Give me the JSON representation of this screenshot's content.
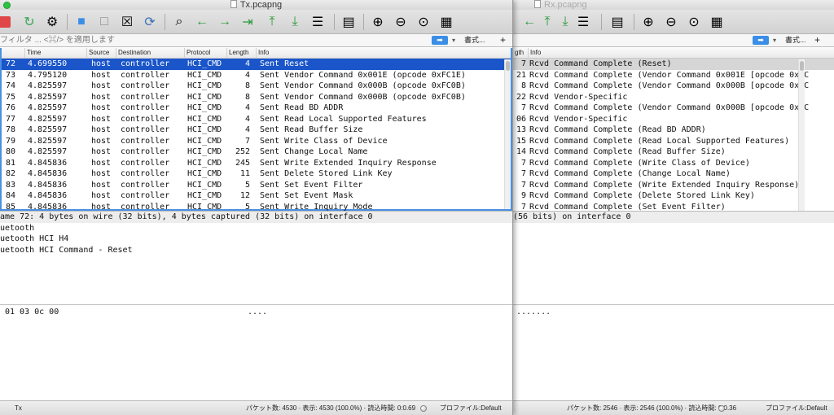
{
  "tx": {
    "title": "Tx.pcapng",
    "filter_placeholder": "フィルタ ... <⌘/> を適用します",
    "format_label": "書式...",
    "add_label": "+",
    "columns": [
      "Time",
      "Source",
      "Destination",
      "Protocol",
      "Length",
      "Info"
    ],
    "rows": [
      {
        "no": "72",
        "time": "4.699550",
        "src": "host",
        "dst": "controller",
        "proto": "HCI_CMD",
        "len": "4",
        "info": "Sent Reset"
      },
      {
        "no": "73",
        "time": "4.795120",
        "src": "host",
        "dst": "controller",
        "proto": "HCI_CMD",
        "len": "4",
        "info": "Sent Vendor Command 0x001E (opcode 0xFC1E)"
      },
      {
        "no": "74",
        "time": "4.825597",
        "src": "host",
        "dst": "controller",
        "proto": "HCI_CMD",
        "len": "8",
        "info": "Sent Vendor Command 0x000B (opcode 0xFC0B)"
      },
      {
        "no": "75",
        "time": "4.825597",
        "src": "host",
        "dst": "controller",
        "proto": "HCI_CMD",
        "len": "8",
        "info": "Sent Vendor Command 0x000B (opcode 0xFC0B)"
      },
      {
        "no": "76",
        "time": "4.825597",
        "src": "host",
        "dst": "controller",
        "proto": "HCI_CMD",
        "len": "4",
        "info": "Sent Read BD ADDR"
      },
      {
        "no": "77",
        "time": "4.825597",
        "src": "host",
        "dst": "controller",
        "proto": "HCI_CMD",
        "len": "4",
        "info": "Sent Read Local Supported Features"
      },
      {
        "no": "78",
        "time": "4.825597",
        "src": "host",
        "dst": "controller",
        "proto": "HCI_CMD",
        "len": "4",
        "info": "Sent Read Buffer Size"
      },
      {
        "no": "79",
        "time": "4.825597",
        "src": "host",
        "dst": "controller",
        "proto": "HCI_CMD",
        "len": "7",
        "info": "Sent Write Class of Device"
      },
      {
        "no": "80",
        "time": "4.825597",
        "src": "host",
        "dst": "controller",
        "proto": "HCI_CMD",
        "len": "252",
        "info": "Sent Change Local Name"
      },
      {
        "no": "81",
        "time": "4.845836",
        "src": "host",
        "dst": "controller",
        "proto": "HCI_CMD",
        "len": "245",
        "info": "Sent Write Extended Inquiry Response"
      },
      {
        "no": "82",
        "time": "4.845836",
        "src": "host",
        "dst": "controller",
        "proto": "HCI_CMD",
        "len": "11",
        "info": "Sent Delete Stored Link Key"
      },
      {
        "no": "83",
        "time": "4.845836",
        "src": "host",
        "dst": "controller",
        "proto": "HCI_CMD",
        "len": "5",
        "info": "Sent Set Event Filter"
      },
      {
        "no": "84",
        "time": "4.845836",
        "src": "host",
        "dst": "controller",
        "proto": "HCI_CMD",
        "len": "12",
        "info": "Sent Set Event Mask"
      },
      {
        "no": "85",
        "time": "4.845836",
        "src": "host",
        "dst": "controller",
        "proto": "HCI_CMD",
        "len": "5",
        "info": "Sent Write Inquiry Mode"
      }
    ],
    "details": [
      "ame 72: 4 bytes on wire (32 bits), 4 bytes captured (32 bits) on interface 0",
      "uetooth",
      "uetooth HCI H4",
      "uetooth HCI Command - Reset"
    ],
    "bytes_hex": "01 03 0c 00",
    "bytes_ascii": "....",
    "status": {
      "name": "Tx",
      "counts": "パケット数: 4530 · 表示: 4530 (100.0%) · 読込時間: 0:0.69",
      "profile": "プロファイル:Default"
    }
  },
  "rx": {
    "title": "Rx.pcapng",
    "format_label": "書式...",
    "add_label": "+",
    "columns": [
      "gth",
      "Info"
    ],
    "rows": [
      {
        "len": "7",
        "info": "Rcvd Command Complete (Reset)"
      },
      {
        "len": "21",
        "info": "Rcvd Command Complete (Vendor Command 0x001E [opcode 0xFC"
      },
      {
        "len": "8",
        "info": "Rcvd Command Complete (Vendor Command 0x000B [opcode 0xFC"
      },
      {
        "len": "22",
        "info": "Rcvd Vendor-Specific"
      },
      {
        "len": "7",
        "info": "Rcvd Command Complete (Vendor Command 0x000B [opcode 0xFC"
      },
      {
        "len": "06",
        "info": "Rcvd Vendor-Specific"
      },
      {
        "len": "13",
        "info": "Rcvd Command Complete (Read BD ADDR)"
      },
      {
        "len": "15",
        "info": "Rcvd Command Complete (Read Local Supported Features)"
      },
      {
        "len": "14",
        "info": "Rcvd Command Complete (Read Buffer Size)"
      },
      {
        "len": "7",
        "info": "Rcvd Command Complete (Write Class of Device)"
      },
      {
        "len": "7",
        "info": "Rcvd Command Complete (Change Local Name)"
      },
      {
        "len": "7",
        "info": "Rcvd Command Complete (Write Extended Inquiry Response)"
      },
      {
        "len": "9",
        "info": "Rcvd Command Complete (Delete Stored Link Key)"
      },
      {
        "len": "7",
        "info": "Rcvd Command Complete (Set Event Filter)"
      }
    ],
    "details": [
      "(56 bits) on interface 0"
    ],
    "bytes_ascii": ".......",
    "status": {
      "counts": "パケット数: 2546 · 表示: 2546 (100.0%) · 読込時間: 0:0.36",
      "profile": "プロファイル:Default"
    }
  },
  "colors": {
    "selection": "#1a55c9",
    "accent": "#3b8ee6",
    "rx_highlight": "#d6d6d6"
  }
}
